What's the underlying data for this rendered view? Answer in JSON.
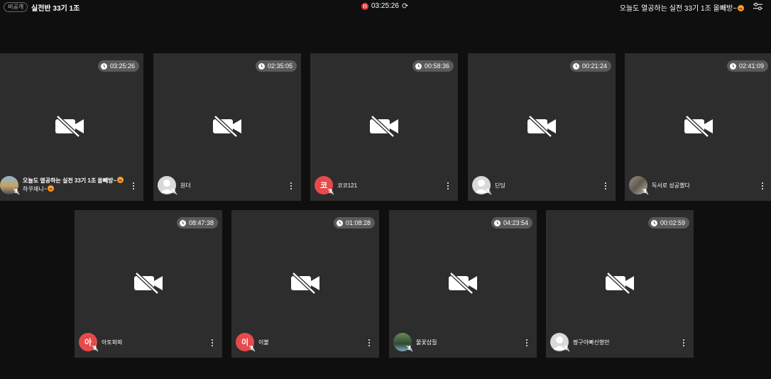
{
  "header": {
    "badge": "비공개",
    "room_title": "실전반 33기 1조",
    "record_time": "03:25:26",
    "notice": "오늘도 열공하는 실전 33기 1조 올빼방~"
  },
  "participants": [
    {
      "time": "03:25:26",
      "name": "오늘도 열공하는 실전 33기 1조 올빼방~",
      "name2": "하쿠재니~",
      "avatar": "photo-a",
      "initial": ""
    },
    {
      "time": "02:35:05",
      "name": "원더",
      "avatar": "grey",
      "initial": ""
    },
    {
      "time": "00:58:36",
      "name": "코코121",
      "avatar": "red",
      "initial": "코"
    },
    {
      "time": "00:21:24",
      "name": "딘딩",
      "avatar": "grey",
      "initial": ""
    },
    {
      "time": "02:41:09",
      "name": "독서로 성공했다",
      "avatar": "photo-b",
      "initial": ""
    },
    {
      "time": "08:47:38",
      "name": "아토파파",
      "avatar": "red",
      "initial": "아"
    },
    {
      "time": "01:08:28",
      "name": "이불",
      "avatar": "red",
      "initial": "이"
    },
    {
      "time": "04:23:54",
      "name": "물꽃삽질",
      "avatar": "photo-c",
      "initial": ""
    },
    {
      "time": "00:02:59",
      "name": "짱구아빠신형만",
      "avatar": "grey",
      "initial": ""
    }
  ],
  "icons": {
    "rec": "record-pause-icon",
    "refresh": "refresh-icon",
    "settings": "settings-sliders-icon",
    "clock": "clock-icon",
    "camera_off": "video-off-icon",
    "mic_off": "mic-off-icon",
    "more": "more-vertical-icon"
  },
  "colors": {
    "background": "#0f0f0f",
    "tile": "#2d2d2d",
    "record": "#e23b3b",
    "avatar_red": "#e64a4a"
  }
}
